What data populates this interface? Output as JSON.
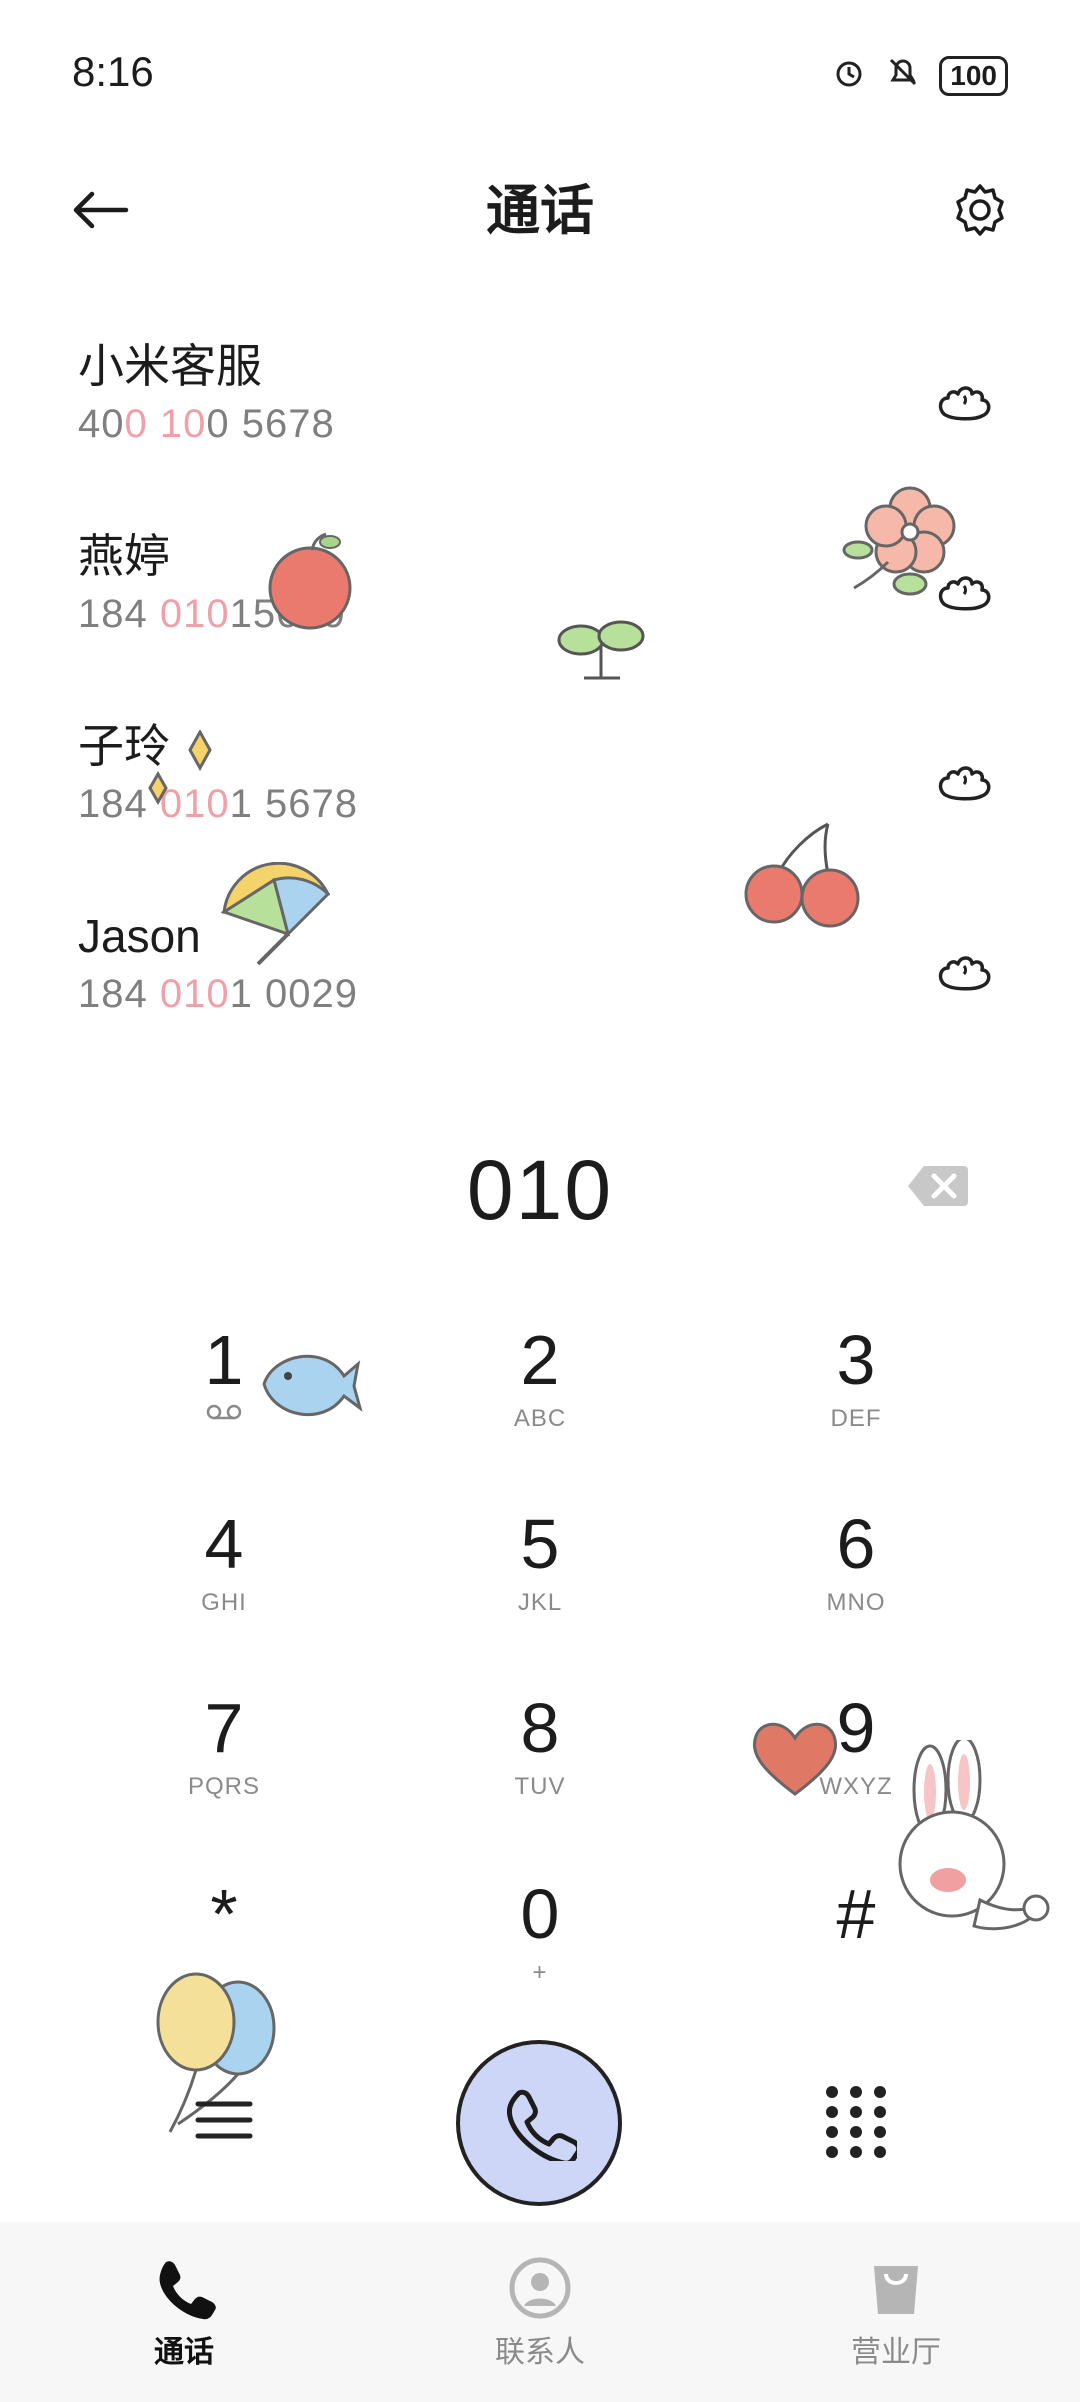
{
  "status": {
    "time": "8:16",
    "battery": "100"
  },
  "header": {
    "title": "通话"
  },
  "contacts": [
    {
      "name": "小米客服",
      "number_parts": [
        "40",
        "0",
        " ",
        "10",
        "0 5678"
      ]
    },
    {
      "name": "燕婷",
      "number_parts": [
        "184 ",
        "010",
        "15689"
      ]
    },
    {
      "name": "子玲",
      "number_parts": [
        "184 ",
        "010",
        "1 5678"
      ]
    },
    {
      "name": "Jason",
      "number_parts": [
        "184 ",
        "010",
        "1 0029"
      ]
    }
  ],
  "dialer": {
    "number": "010"
  },
  "keypad": [
    {
      "digit": "1",
      "sub": ""
    },
    {
      "digit": "2",
      "sub": "ABC"
    },
    {
      "digit": "3",
      "sub": "DEF"
    },
    {
      "digit": "4",
      "sub": "GHI"
    },
    {
      "digit": "5",
      "sub": "JKL"
    },
    {
      "digit": "6",
      "sub": "MNO"
    },
    {
      "digit": "7",
      "sub": "PQRS"
    },
    {
      "digit": "8",
      "sub": "TUV"
    },
    {
      "digit": "9",
      "sub": "WXYZ"
    },
    {
      "digit": "*",
      "sub": ""
    },
    {
      "digit": "0",
      "sub": "+"
    },
    {
      "digit": "#",
      "sub": ""
    }
  ],
  "nav": {
    "items": [
      {
        "label": "通话",
        "icon": "phone-icon",
        "active": true
      },
      {
        "label": "联系人",
        "icon": "person-icon",
        "active": false
      },
      {
        "label": "营业厅",
        "icon": "shopping-bag-icon",
        "active": false
      }
    ]
  },
  "colors": {
    "accent_highlight": "#f0a0a8",
    "call_button": "#cdd6f6"
  }
}
